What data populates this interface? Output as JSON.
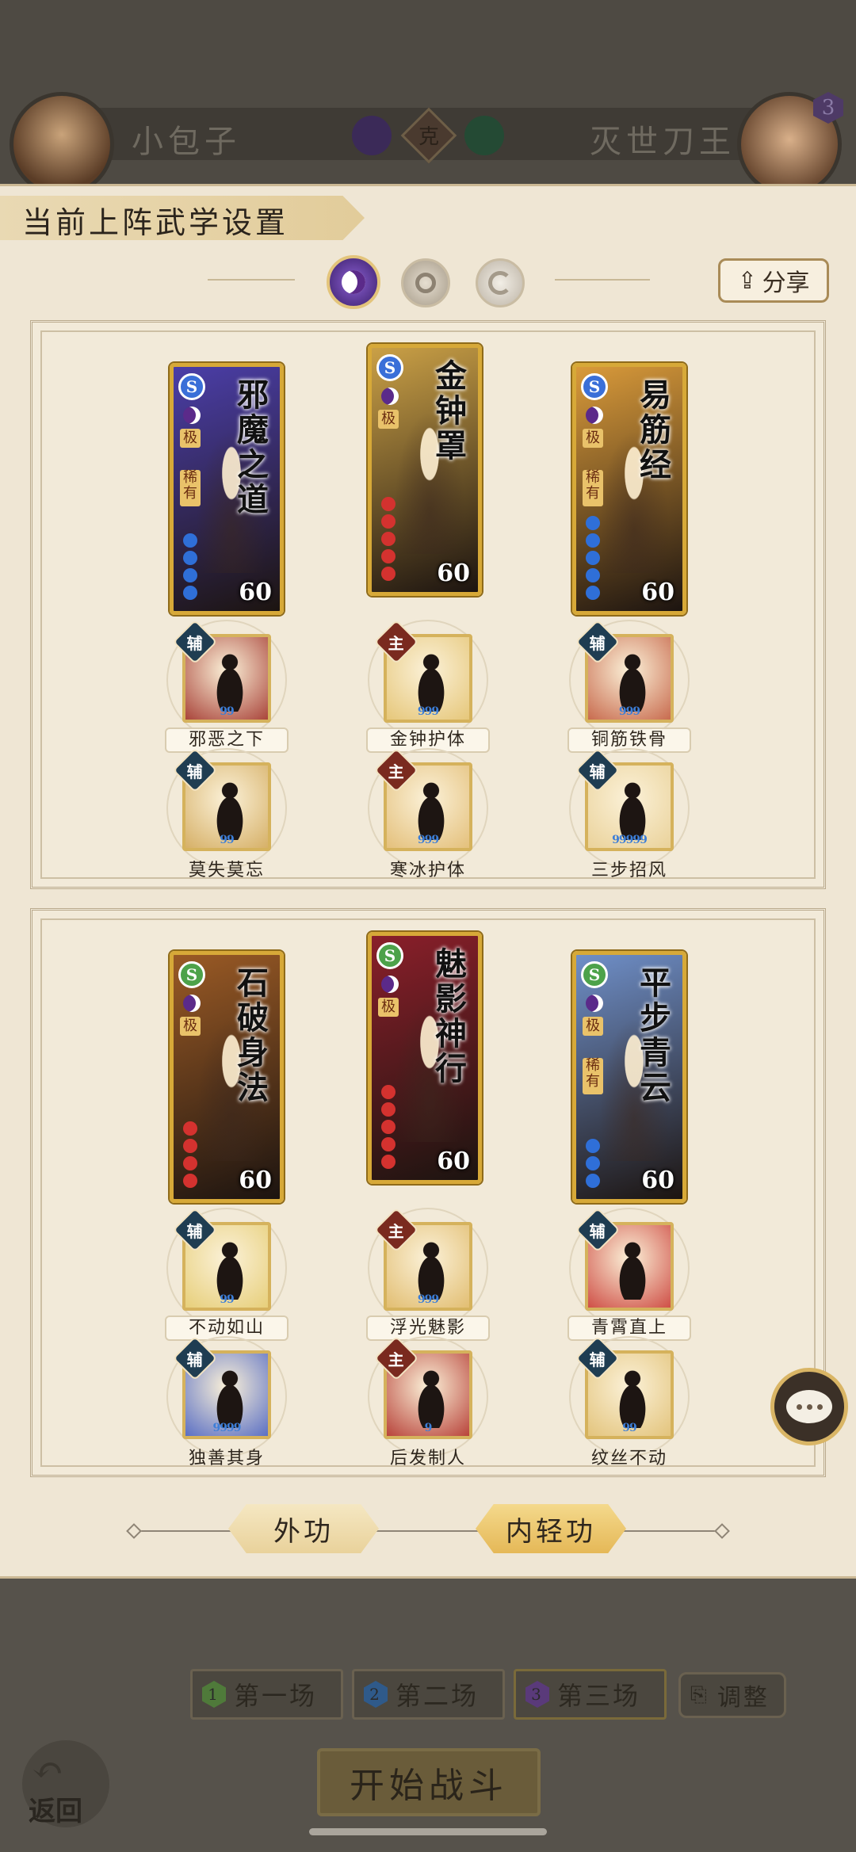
{
  "header": {
    "left_player": "小包子",
    "right_player": "灭世刀王",
    "vs_label": "克",
    "right_badge": "3"
  },
  "panel": {
    "title": "当前上阵武学设置",
    "share_label": "分享",
    "share_icon": "share-icon"
  },
  "sets": [
    {
      "cards": [
        {
          "name": "邪魔之道",
          "level": "60",
          "tags": [
            "极",
            "稀有"
          ],
          "badge": "S",
          "badge_color": "#3a6fd8",
          "bg": "#4b3ea8",
          "dots": [
            "#2f6fd8",
            "#2f6fd8",
            "#2f6fd8",
            "#2f6fd8"
          ]
        },
        {
          "name": "金钟罩",
          "level": "60",
          "tags": [
            "极"
          ],
          "badge": "S",
          "badge_color": "#3a6fd8",
          "bg": "#caa046",
          "dots": [
            "#d4322f",
            "#d4322f",
            "#d4322f",
            "#d4322f",
            "#d4322f"
          ]
        },
        {
          "name": "易筋经",
          "level": "60",
          "tags": [
            "极",
            "稀有"
          ],
          "badge": "S",
          "badge_color": "#3a6fd8",
          "bg": "#d99a3a",
          "dots": [
            "#2f6fd8",
            "#2f6fd8",
            "#2f6fd8",
            "#2f6fd8",
            "#2f6fd8"
          ]
        }
      ],
      "skills": [
        {
          "type": "辅",
          "label": "邪恶之下",
          "bg": "#a9443a",
          "boxed": true,
          "pips": "99"
        },
        {
          "type": "主",
          "label": "金钟护体",
          "bg": "#e6c77a",
          "boxed": true,
          "pips": "999"
        },
        {
          "type": "辅",
          "label": "铜筋铁骨",
          "bg": "#c86b4e",
          "boxed": true,
          "pips": "999"
        },
        {
          "type": "辅",
          "label": "莫失莫忘",
          "bg": "#d6b067",
          "boxed": false,
          "pips": "99"
        },
        {
          "type": "主",
          "label": "寒冰护体",
          "bg": "#e4c07b",
          "boxed": false,
          "pips": "999"
        },
        {
          "type": "辅",
          "label": "三步招风",
          "bg": "#ead29a",
          "boxed": false,
          "pips": "99999"
        }
      ]
    },
    {
      "cards": [
        {
          "name": "石破身法",
          "level": "60",
          "tags": [
            "极"
          ],
          "badge": "S",
          "badge_color": "#4da24a",
          "bg": "#9a5a25",
          "dots": [
            "#d4322f",
            "#d4322f",
            "#d4322f",
            "#d4322f"
          ]
        },
        {
          "name": "魅影神行",
          "level": "60",
          "tags": [
            "极"
          ],
          "badge": "S",
          "badge_color": "#4da24a",
          "bg": "#8a1f2a",
          "dots": [
            "#d4322f",
            "#d4322f",
            "#d4322f",
            "#d4322f",
            "#d4322f"
          ]
        },
        {
          "name": "平步青云",
          "level": "60",
          "tags": [
            "极",
            "稀有"
          ],
          "badge": "S",
          "badge_color": "#4da24a",
          "bg": "#6f8fc8",
          "dots": [
            "#2f6fd8",
            "#2f6fd8",
            "#2f6fd8"
          ]
        }
      ],
      "skills": [
        {
          "type": "辅",
          "label": "不动如山",
          "bg": "#e7cf7a",
          "boxed": true,
          "pips": "99"
        },
        {
          "type": "主",
          "label": "浮光魅影",
          "bg": "#e2be72",
          "boxed": true,
          "pips": "999"
        },
        {
          "type": "辅",
          "label": "青霄直上",
          "bg": "#cf4f46",
          "boxed": true,
          "pips": ""
        },
        {
          "type": "辅",
          "label": "独善其身",
          "bg": "#5a6fc4",
          "boxed": false,
          "pips": "9999"
        },
        {
          "type": "主",
          "label": "后发制人",
          "bg": "#b8433a",
          "boxed": false,
          "pips": "9"
        },
        {
          "type": "辅",
          "label": "纹丝不动",
          "bg": "#e3c47c",
          "boxed": false,
          "pips": "99"
        }
      ]
    }
  ],
  "tabs": {
    "outer": "外功",
    "inner": "内轻功"
  },
  "stages": [
    {
      "num": "1",
      "label": "第一场",
      "color": "#4f7a3a"
    },
    {
      "num": "2",
      "label": "第二场",
      "color": "#2f5a8a"
    },
    {
      "num": "3",
      "label": "第三场",
      "color": "#5a3a7a"
    }
  ],
  "adjust_label": "调整",
  "start_label": "开始战斗",
  "back_label": "返回",
  "colors": {
    "panel": "#efe6d4",
    "gold": "#d7a938",
    "dim": "#56524b"
  }
}
